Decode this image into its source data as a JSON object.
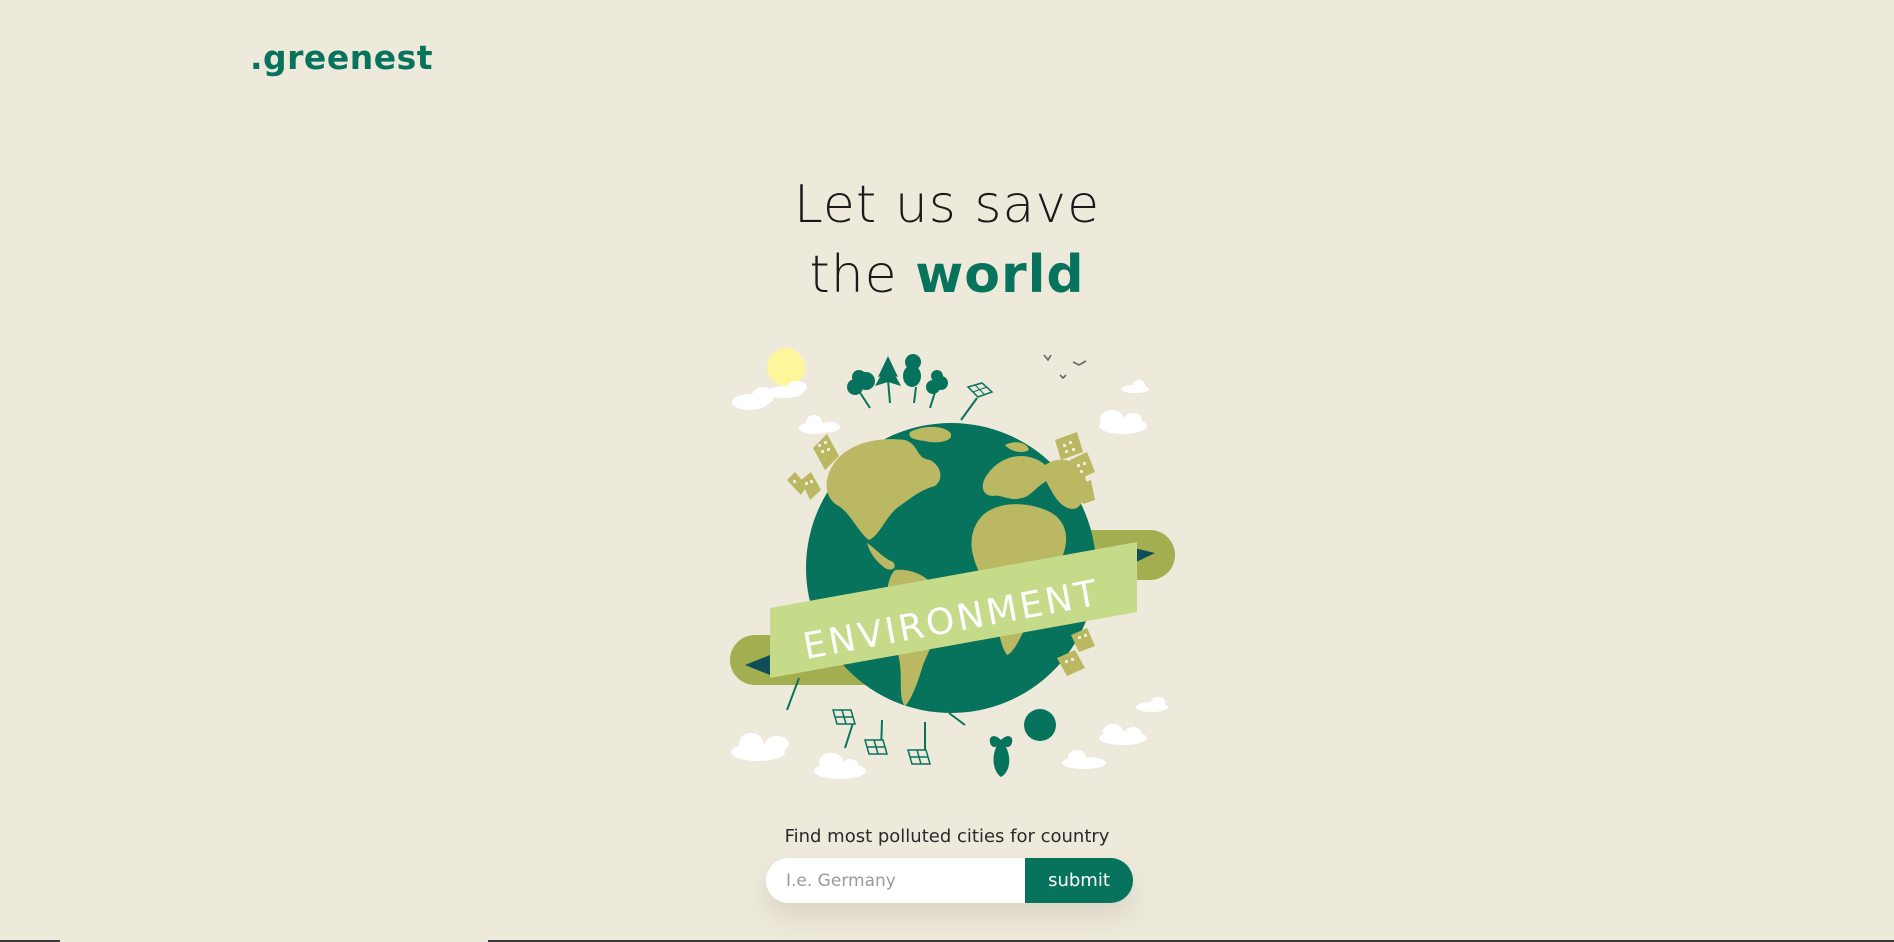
{
  "brand": {
    "logo_text": ".greenest",
    "color": "#08735c"
  },
  "hero": {
    "line1": "Let us save",
    "line2_prefix": "the",
    "line2_accent": "world"
  },
  "illustration": {
    "banner_text": "ENVIRONMENT",
    "icon": "earth-environment-illustration"
  },
  "search": {
    "label": "Find most polluted cities for country",
    "placeholder": "I.e. Germany",
    "value": "",
    "submit_label": "submit"
  },
  "colors": {
    "background": "#ede9db",
    "accent": "#08735c",
    "land": "#bab862",
    "banner": "#c5db8a",
    "banner_tail": "#a2ae50"
  }
}
